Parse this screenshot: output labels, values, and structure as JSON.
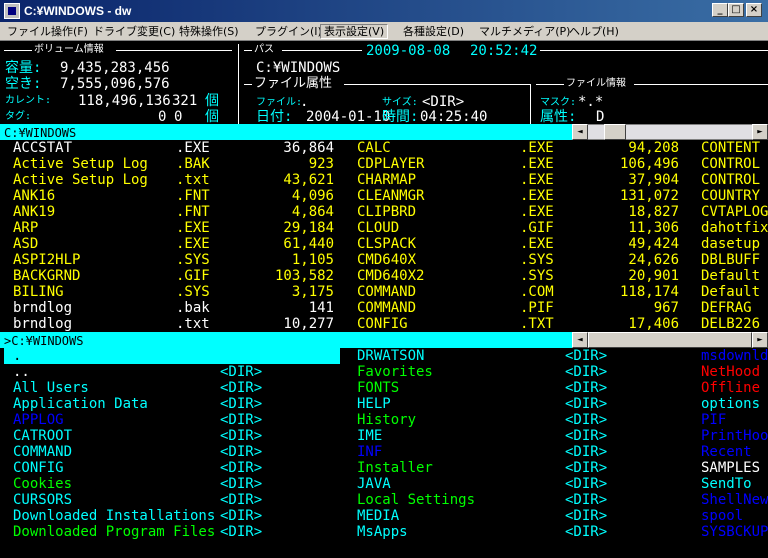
{
  "window": {
    "title": "C:¥WINDOWS - dw",
    "minimize": "_",
    "maximize": "□",
    "close": "×"
  },
  "menu": [
    "ファイル操作(F)",
    "ドライブ変更(C)",
    "特殊操作(S)",
    "プラグイン(I)",
    "表示設定(V)",
    "各種設定(D)",
    "マルチメディア(P)",
    "ヘルプ(H)"
  ],
  "volume": {
    "header": "ボリューム情報",
    "capacity_label": "容量:",
    "capacity": "9,435,283,456",
    "free_label": "空き:",
    "free": "7,555,096,576",
    "current_label": "カレント:",
    "current_size": "118,496,136",
    "current_count": "321",
    "tag_label": "タグ:",
    "tag_size": "0",
    "tag_count": "0",
    "unit": "個"
  },
  "path": {
    "header": "パス",
    "date": "2009-08-08",
    "time": "20:52:42",
    "value": "C:¥WINDOWS"
  },
  "file_attr": {
    "header": "ファイル属性",
    "file_label": "ファイル:",
    "file_value": ".",
    "size_label": "サイズ:",
    "size_value": "<DIR>",
    "date_label": "日付:",
    "date_value": "2004-01-10",
    "time_label": "時間:",
    "time_value": "04:25:40"
  },
  "file_info": {
    "header": "ファイル情報",
    "mask_label": "マスク:",
    "mask_value": "*.*",
    "attr_label": "属性:",
    "attr_value": "D"
  },
  "colors": {
    "bar": "#00ffff",
    "file": "#ffffff",
    "hidden": "#ffff00",
    "system": "#00ff00"
  },
  "upper_pane": {
    "path": "C:¥WINDOWS",
    "scroll_left": "◄",
    "scroll_right": "►",
    "col1": [
      {
        "name": "ACCSTAT",
        "ext": ".EXE",
        "size": "36,864",
        "color": "#ffffff"
      },
      {
        "name": "Active Setup Log",
        "ext": ".BAK",
        "size": "923",
        "color": "#ffff00"
      },
      {
        "name": "Active Setup Log",
        "ext": ".txt",
        "size": "43,621",
        "color": "#ffff00"
      },
      {
        "name": "ANK16",
        "ext": ".FNT",
        "size": "4,096",
        "color": "#ffff00"
      },
      {
        "name": "ANK19",
        "ext": ".FNT",
        "size": "4,864",
        "color": "#ffff00"
      },
      {
        "name": "ARP",
        "ext": ".EXE",
        "size": "29,184",
        "color": "#ffff00"
      },
      {
        "name": "ASD",
        "ext": ".EXE",
        "size": "61,440",
        "color": "#ffff00"
      },
      {
        "name": "ASPI2HLP",
        "ext": ".SYS",
        "size": "1,105",
        "color": "#ffff00"
      },
      {
        "name": "BACKGRND",
        "ext": ".GIF",
        "size": "103,582",
        "color": "#ffff00"
      },
      {
        "name": "BILING",
        "ext": ".SYS",
        "size": "3,175",
        "color": "#ffff00"
      },
      {
        "name": "brndlog",
        "ext": ".bak",
        "size": "141",
        "color": "#ffffff"
      },
      {
        "name": "brndlog",
        "ext": ".txt",
        "size": "10,277",
        "color": "#ffffff"
      }
    ],
    "col2": [
      {
        "name": "CALC",
        "ext": ".EXE",
        "size": "94,208",
        "color": "#ffff00"
      },
      {
        "name": "CDPLAYER",
        "ext": ".EXE",
        "size": "106,496",
        "color": "#ffff00"
      },
      {
        "name": "CHARMAP",
        "ext": ".EXE",
        "size": "37,904",
        "color": "#ffff00"
      },
      {
        "name": "CLEANMGR",
        "ext": ".EXE",
        "size": "131,072",
        "color": "#ffff00"
      },
      {
        "name": "CLIPBRD",
        "ext": ".EXE",
        "size": "18,827",
        "color": "#ffff00"
      },
      {
        "name": "CLOUD",
        "ext": ".GIF",
        "size": "11,306",
        "color": "#ffff00"
      },
      {
        "name": "CLSPACK",
        "ext": ".EXE",
        "size": "49,424",
        "color": "#ffff00"
      },
      {
        "name": "CMD640X",
        "ext": ".SYS",
        "size": "24,626",
        "color": "#ffff00"
      },
      {
        "name": "CMD640X2",
        "ext": ".SYS",
        "size": "20,901",
        "color": "#ffff00"
      },
      {
        "name": "COMMAND",
        "ext": ".COM",
        "size": "118,174",
        "color": "#ffff00"
      },
      {
        "name": "COMMAND",
        "ext": ".PIF",
        "size": "967",
        "color": "#ffff00"
      },
      {
        "name": "CONFIG",
        "ext": ".TXT",
        "size": "17,406",
        "color": "#ffff00"
      }
    ],
    "col3": [
      {
        "name": "CONTENT",
        "color": "#ffff00"
      },
      {
        "name": "CONTROL",
        "color": "#ffff00"
      },
      {
        "name": "CONTROL",
        "color": "#ffff00"
      },
      {
        "name": "COUNTRY",
        "color": "#ffff00"
      },
      {
        "name": "CVTAPLOG",
        "color": "#ffff00"
      },
      {
        "name": "dahotfix",
        "color": "#ffff00"
      },
      {
        "name": "dasetup",
        "color": "#ffff00"
      },
      {
        "name": "DBLBUFF",
        "color": "#ffff00"
      },
      {
        "name": "Default",
        "color": "#ffff00"
      },
      {
        "name": "Default",
        "color": "#ffff00"
      },
      {
        "name": "DEFRAG",
        "color": "#ffff00"
      },
      {
        "name": "DELB226",
        "color": "#ffff00"
      }
    ]
  },
  "lower_pane": {
    "path": ">C:¥WINDOWS",
    "scroll_left": "◄",
    "scroll_right": "►",
    "col1": [
      {
        "name": ".",
        "size": "<DIR>",
        "color": "#000000"
      },
      {
        "name": "..",
        "size": "<DIR>",
        "color": "#ffffff"
      },
      {
        "name": "All Users",
        "size": "<DIR>",
        "color": "#00ffff"
      },
      {
        "name": "Application Data",
        "size": "<DIR>",
        "color": "#00ffff"
      },
      {
        "name": "APPLOG",
        "size": "<DIR>",
        "color": "#0000ff"
      },
      {
        "name": "CATROOT",
        "size": "<DIR>",
        "color": "#00ffff"
      },
      {
        "name": "COMMAND",
        "size": "<DIR>",
        "color": "#00ffff"
      },
      {
        "name": "CONFIG",
        "size": "<DIR>",
        "color": "#00ffff"
      },
      {
        "name": "Cookies",
        "size": "<DIR>",
        "color": "#00ff00"
      },
      {
        "name": "CURSORS",
        "size": "<DIR>",
        "color": "#00ffff"
      },
      {
        "name": "Downloaded Installations",
        "size": "<DIR>",
        "color": "#00ffff"
      },
      {
        "name": "Downloaded Program Files",
        "size": "<DIR>",
        "color": "#00ff00"
      }
    ],
    "col2": [
      {
        "name": "DRWATSON",
        "size": "<DIR>",
        "color": "#00ffff"
      },
      {
        "name": "Favorites",
        "size": "<DIR>",
        "color": "#00ff00"
      },
      {
        "name": "FONTS",
        "size": "<DIR>",
        "color": "#00ff00"
      },
      {
        "name": "HELP",
        "size": "<DIR>",
        "color": "#00ffff"
      },
      {
        "name": "History",
        "size": "<DIR>",
        "color": "#00ff00"
      },
      {
        "name": "IME",
        "size": "<DIR>",
        "color": "#00ffff"
      },
      {
        "name": "INF",
        "size": "<DIR>",
        "color": "#0000ff"
      },
      {
        "name": "Installer",
        "size": "<DIR>",
        "color": "#00ff00"
      },
      {
        "name": "JAVA",
        "size": "<DIR>",
        "color": "#00ffff"
      },
      {
        "name": "Local Settings",
        "size": "<DIR>",
        "color": "#00ff00"
      },
      {
        "name": "MEDIA",
        "size": "<DIR>",
        "color": "#00ffff"
      },
      {
        "name": "MsApps",
        "size": "<DIR>",
        "color": "#00ffff"
      }
    ],
    "col3": [
      {
        "name": "msdownld",
        "color": "#0000ff"
      },
      {
        "name": "NetHood",
        "color": "#ff0000"
      },
      {
        "name": "Offline",
        "color": "#ff0000"
      },
      {
        "name": "options",
        "color": "#00ffff"
      },
      {
        "name": "PIF",
        "color": "#0000ff"
      },
      {
        "name": "PrintHood",
        "color": "#0000ff"
      },
      {
        "name": "Recent",
        "color": "#0000ff"
      },
      {
        "name": "SAMPLES",
        "color": "#ffffff"
      },
      {
        "name": "SendTo",
        "color": "#00ffff"
      },
      {
        "name": "ShellNew",
        "color": "#0000ff"
      },
      {
        "name": "spool",
        "color": "#0000ff"
      },
      {
        "name": "SYSBCKUP",
        "color": "#0000ff"
      }
    ]
  }
}
